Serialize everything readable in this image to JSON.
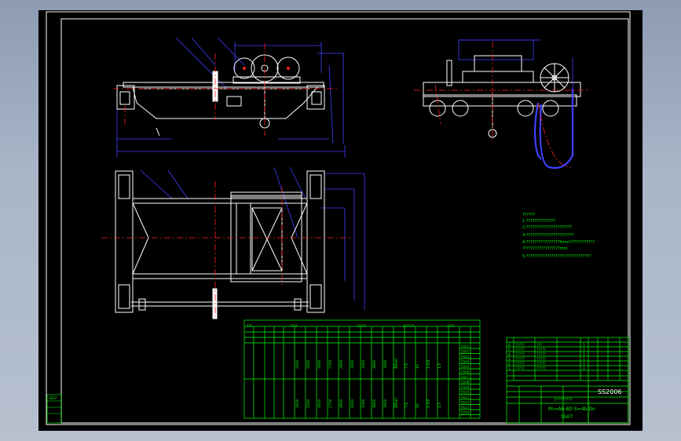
{
  "drawing": {
    "drawing_number": "SS2006",
    "spec_line": "Pn=Ab-8D  S=4b-Dn",
    "sheet_code": "SS07",
    "title_placeholder": "?????????"
  },
  "notes": {
    "lines": [
      "??????",
      "1.??????????????",
      "2.??????????????????????",
      "3.???????????????????????",
      "4.????????????????5mm????????????",
      "   ??????????????????mm",
      "5.???????????????????????????????"
    ]
  },
  "parts_table": {
    "numbers": [
      "6",
      "5",
      "4",
      "3",
      "2",
      "1"
    ],
    "codes": [
      "?????",
      "?????",
      "?????",
      "?????",
      "?????",
      "?????"
    ],
    "names": [
      "???",
      "?????",
      "?????",
      "?????",
      "?????",
      "?????"
    ],
    "qty": [
      "1",
      "1",
      "1",
      "1",
      "1",
      "2"
    ]
  },
  "spec_table": {
    "row_values_top": [
      "2400",
      "2500",
      "2600",
      "2700",
      "2800",
      "3000",
      "3300",
      "3600",
      "3900",
      "20-40"
    ],
    "row_values_bottom": [
      "2400",
      "2500",
      "2600",
      "2700",
      "2800",
      "3000",
      "3300",
      "3600",
      "3900",
      "20-40"
    ],
    "right_values_top": [
      "7.5",
      "7.5",
      "10",
      "1.5/5",
      "1.5"
    ],
    "right_values_bottom": [
      "7.5",
      "7.5",
      "10",
      "1.5/5",
      "1.5"
    ],
    "side_codes": [
      "SS01",
      "SS02",
      "SS03",
      "SS04",
      "SS05",
      "SS06",
      "SS07",
      "SS08",
      "SS09",
      "SS10",
      "SS11",
      "SS12",
      "SS13",
      "SS14",
      "SS15"
    ]
  },
  "colors": {
    "frame": "#ffffff",
    "table": "#00ff00",
    "dimension": "#4040ff",
    "centerline": "#ff2020",
    "text_green": "#00ff00",
    "accent_cyan": "#00ffff"
  },
  "status": {
    "legend_label": "SS07"
  }
}
